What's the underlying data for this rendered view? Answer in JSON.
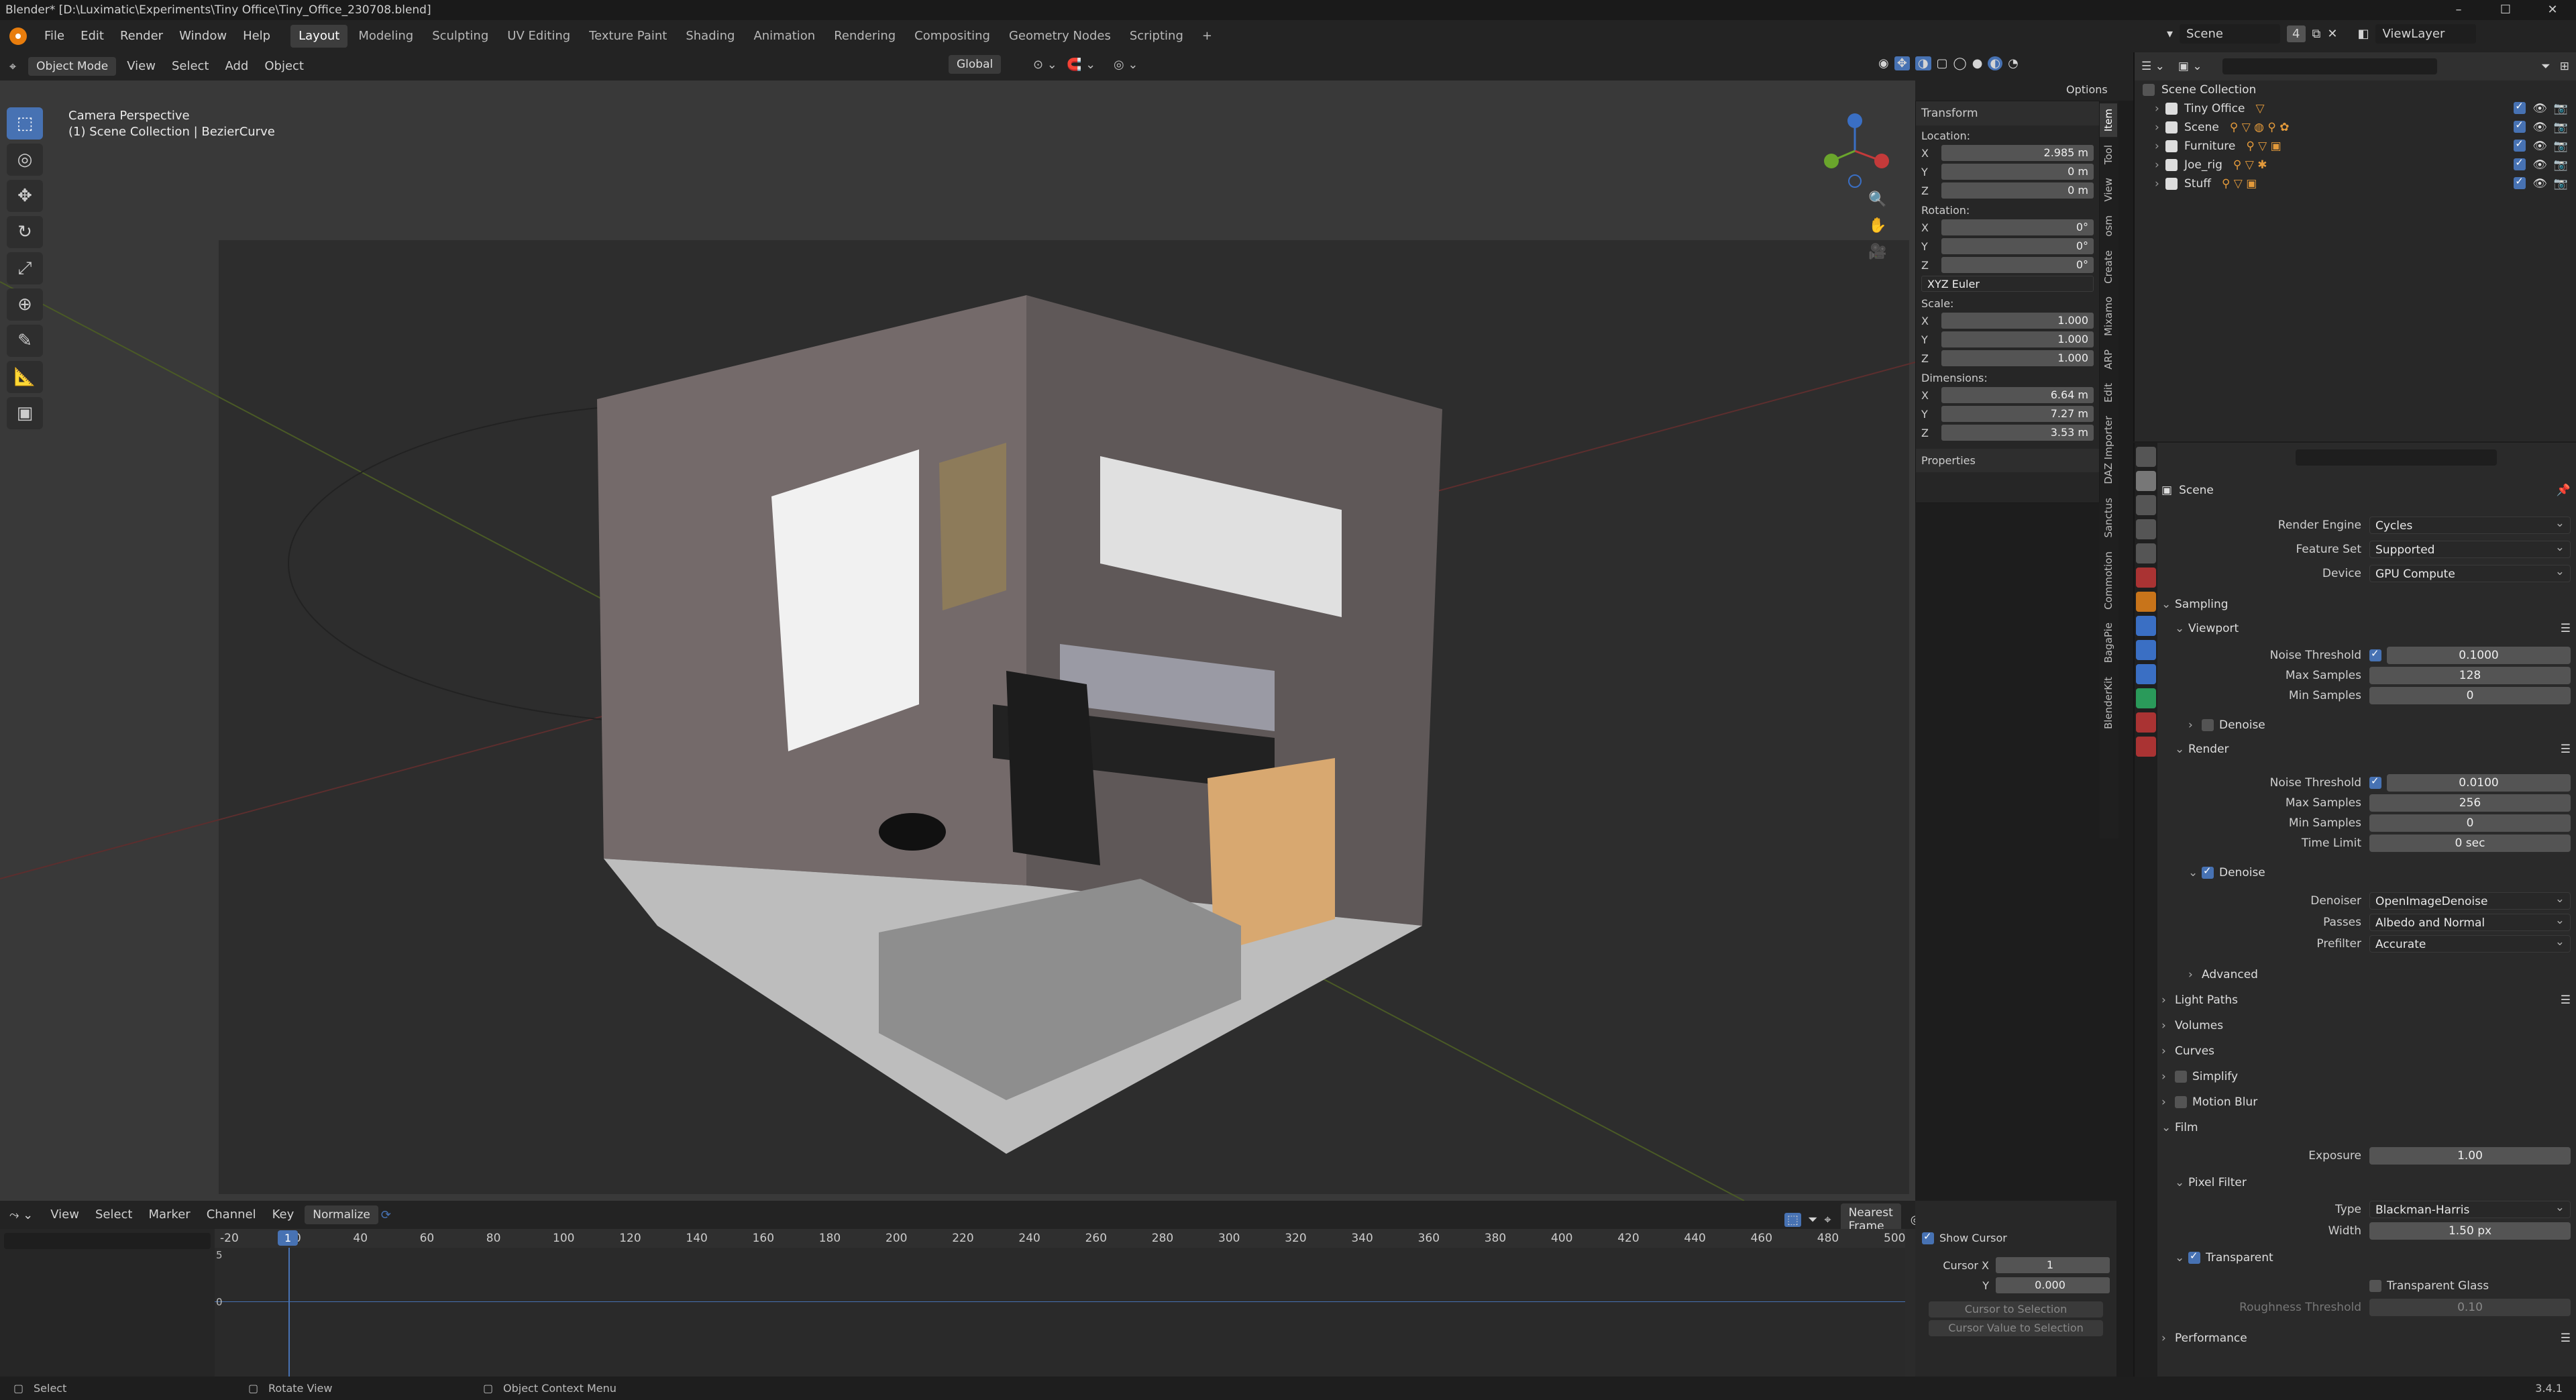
{
  "titlebar": {
    "title": "Blender* [D:\\Luximatic\\Experiments\\Tiny Office\\Tiny_Office_230708.blend]"
  },
  "menus": [
    "File",
    "Edit",
    "Render",
    "Window",
    "Help"
  ],
  "workspaces": [
    "Layout",
    "Modeling",
    "Sculpting",
    "UV Editing",
    "Texture Paint",
    "Shading",
    "Animation",
    "Rendering",
    "Compositing",
    "Geometry Nodes",
    "Scripting"
  ],
  "scene": {
    "label": "Scene",
    "count": "4",
    "viewlayer": "ViewLayer"
  },
  "viewport_header": {
    "mode": "Object Mode",
    "menus": [
      "View",
      "Select",
      "Add",
      "Object"
    ],
    "orientation": "Global",
    "options": "Options"
  },
  "viewport_overlay": {
    "line1": "Camera Perspective",
    "line2": "(1) Scene Collection | BezierCurve"
  },
  "npanel": {
    "header": "Transform",
    "location_label": "Location:",
    "location": {
      "x": "2.985 m",
      "y": "0 m",
      "z": "0 m"
    },
    "rotation_label": "Rotation:",
    "rotation": {
      "x": "0°",
      "y": "0°",
      "z": "0°"
    },
    "rotation_mode": "XYZ Euler",
    "scale_label": "Scale:",
    "scale": {
      "x": "1.000",
      "y": "1.000",
      "z": "1.000"
    },
    "dimensions_label": "Dimensions:",
    "dimensions": {
      "x": "6.64 m",
      "y": "7.27 m",
      "z": "3.53 m"
    },
    "properties": "Properties",
    "axes": {
      "x": "X",
      "y": "Y",
      "z": "Z"
    }
  },
  "sidebar_tabs": [
    "Item",
    "Tool",
    "View",
    "osm",
    "Create",
    "Mixamo",
    "ARP",
    "Edit",
    "DAZ Importer",
    "Sanctus",
    "Commotion",
    "BagaPie",
    "BlenderKit"
  ],
  "outliner": {
    "root": "Scene Collection",
    "items": [
      "Tiny Office",
      "Scene",
      "Furniture",
      "Joe_rig",
      "Stuff"
    ]
  },
  "properties": {
    "context": "Scene",
    "render_engine_label": "Render Engine",
    "render_engine": "Cycles",
    "feature_set_label": "Feature Set",
    "feature_set": "Supported",
    "device_label": "Device",
    "device": "GPU Compute",
    "sampling": "Sampling",
    "viewport": "Viewport",
    "noise_threshold_label": "Noise Threshold",
    "vp_noise_threshold": "0.1000",
    "max_samples_label": "Max Samples",
    "vp_max_samples": "128",
    "min_samples_label": "Min Samples",
    "vp_min_samples": "0",
    "denoise": "Denoise",
    "render": "Render",
    "r_noise_threshold": "0.0100",
    "r_max_samples": "256",
    "r_min_samples": "0",
    "time_limit_label": "Time Limit",
    "time_limit": "0 sec",
    "denoiser_label": "Denoiser",
    "denoiser": "OpenImageDenoise",
    "passes_label": "Passes",
    "passes": "Albedo and Normal",
    "prefilter_label": "Prefilter",
    "prefilter": "Accurate",
    "advanced": "Advanced",
    "light_paths": "Light Paths",
    "volumes": "Volumes",
    "curves": "Curves",
    "simplify": "Simplify",
    "motion_blur": "Motion Blur",
    "film": "Film",
    "exposure_label": "Exposure",
    "exposure": "1.00",
    "pixel_filter": "Pixel Filter",
    "type_label": "Type",
    "filter_type": "Blackman-Harris",
    "width_label": "Width",
    "width": "1.50 px",
    "transparent": "Transparent",
    "transparent_glass": "Transparent Glass",
    "roughness_label": "Roughness Threshold",
    "roughness": "0.10",
    "performance": "Performance"
  },
  "timeline": {
    "menus": [
      "View",
      "Select",
      "Marker",
      "Channel",
      "Key"
    ],
    "normalize": "Normalize",
    "snap": "Nearest Frame",
    "current_frame": "1",
    "ticks": [
      "-20",
      "20",
      "40",
      "60",
      "80",
      "100",
      "120",
      "140",
      "160",
      "180",
      "200",
      "220",
      "240",
      "260",
      "280",
      "300",
      "320",
      "340",
      "360",
      "380",
      "400",
      "420",
      "440",
      "460",
      "480",
      "500"
    ],
    "y_labels": [
      "5",
      "0"
    ]
  },
  "cursor_panel": {
    "show_cursor": "Show Cursor",
    "cursor_x_label": "Cursor X",
    "cursor_x": "1",
    "y_label": "Y",
    "cursor_y": "0.000",
    "to_selection": "Cursor to Selection",
    "value_to_selection": "Cursor Value to Selection"
  },
  "status": {
    "select": "Select",
    "rotate": "Rotate View",
    "context": "Object Context Menu",
    "version": "3.4.1"
  }
}
